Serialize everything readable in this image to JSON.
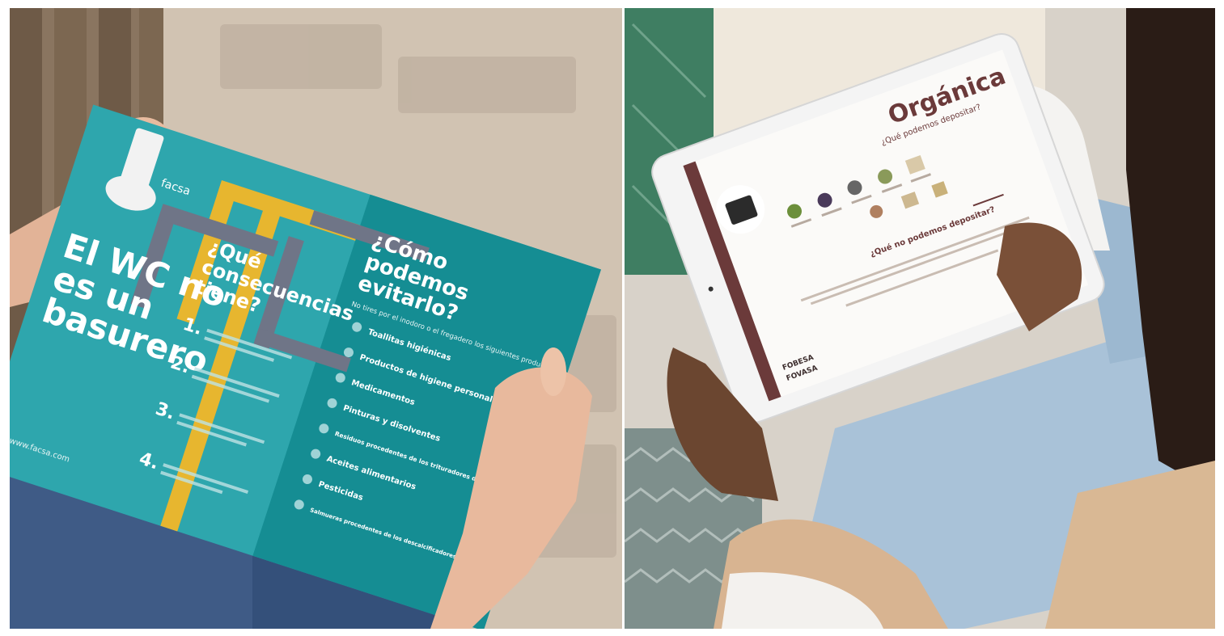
{
  "left_photo": {
    "brochure": {
      "brand": "facsa",
      "headline_lines": [
        "El WC no",
        "es un",
        "basurero"
      ],
      "consequences_title_lines": [
        "¿Qué",
        "consecuencias",
        "tiene?"
      ],
      "avoid_title_lines": [
        "¿Cómo",
        "podemos",
        "evitarlo?"
      ],
      "avoid_intro": "No tires por el inodoro o el fregadero los siguientes productos:",
      "numbers": [
        "1.",
        "2.",
        "3.",
        "4."
      ],
      "items": [
        "Toallitas higiénicas",
        "Productos de higiene personal",
        "Medicamentos",
        "Pinturas y disolventes",
        "Residuos procedentes de los trituradores de basura",
        "Aceites alimentarios",
        "Pesticidas",
        "Salmueras procedentes de los descalcificadores domésticos"
      ],
      "website": "www.facsa.com"
    }
  },
  "right_photo": {
    "tablet": {
      "title": "Orgánica",
      "question_yes": "¿Qué podemos depositar?",
      "question_no_parts": [
        "¿Qué ",
        "no",
        " podemos depositar?"
      ],
      "brands": [
        "FOBESA",
        "FOVASA"
      ]
    }
  },
  "colors": {
    "teal": "#1f9ea4",
    "dark_teal": "#0f7c83",
    "yellow": "#e7b62f",
    "pipe_grey": "#6f7587",
    "maroon": "#6b3a3a",
    "denim": "#3f5b86"
  }
}
